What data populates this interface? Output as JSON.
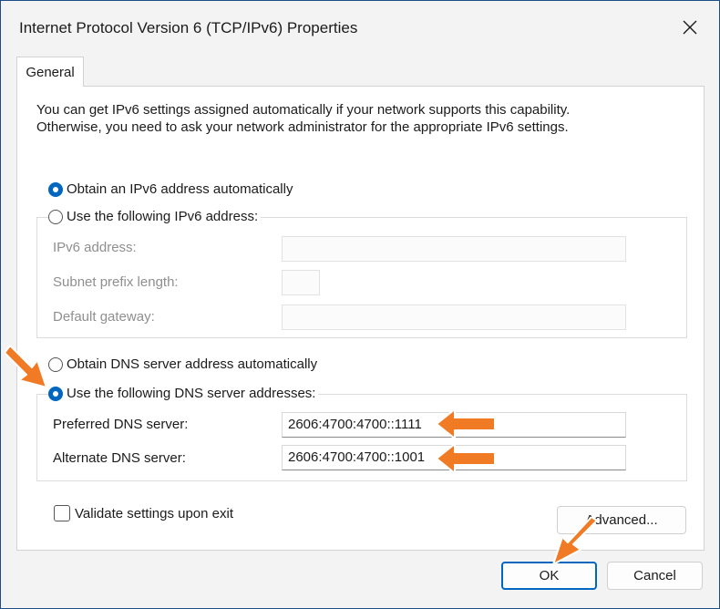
{
  "window": {
    "title": "Internet Protocol Version 6 (TCP/IPv6) Properties",
    "close_icon": "close-icon"
  },
  "tabs": [
    {
      "label": "General",
      "selected": true
    }
  ],
  "description": {
    "line1": "You can get IPv6 settings assigned automatically if your network supports this capability.",
    "line2": "Otherwise, you need to ask your network administrator for the appropriate IPv6 settings."
  },
  "ip_section": {
    "auto_label": "Obtain an IPv6 address automatically",
    "auto_selected": true,
    "manual_label": "Use the following IPv6 address:",
    "manual_selected": false,
    "fields": {
      "address_label": "IPv6 address:",
      "address_value": "",
      "prefix_label": "Subnet prefix length:",
      "prefix_value": "",
      "gateway_label": "Default gateway:",
      "gateway_value": ""
    }
  },
  "dns_section": {
    "auto_label": "Obtain DNS server address automatically",
    "auto_selected": false,
    "manual_label": "Use the following DNS server addresses:",
    "manual_selected": true,
    "preferred_label": "Preferred DNS server:",
    "preferred_value": "2606:4700:4700::1111",
    "alternate_label": "Alternate DNS server:",
    "alternate_value": "2606:4700:4700::1001"
  },
  "validate": {
    "label": "Validate settings upon exit",
    "checked": false
  },
  "buttons": {
    "advanced": "Advanced...",
    "ok": "OK",
    "cancel": "Cancel"
  },
  "annotation": {
    "arrow_color": "#f07b24"
  },
  "colors": {
    "accent": "#0067c0",
    "background": "#1d4f86"
  }
}
